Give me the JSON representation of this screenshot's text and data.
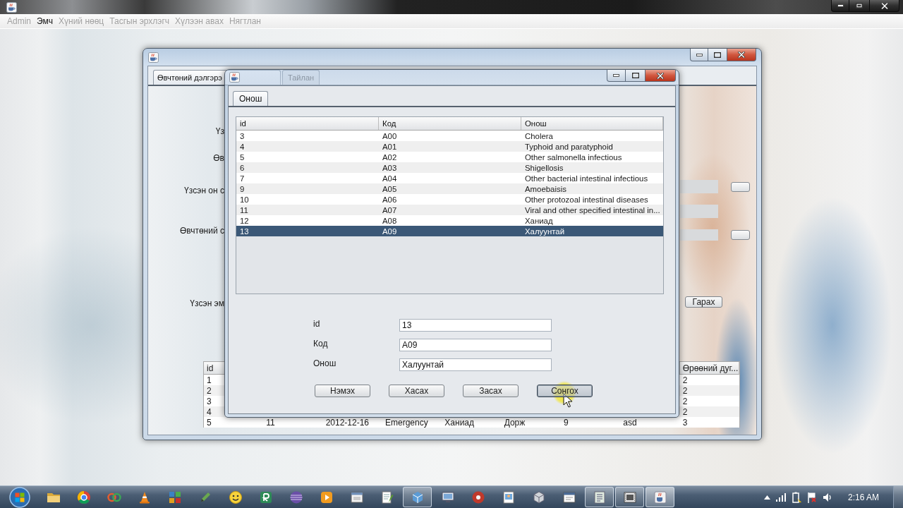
{
  "app_window": {
    "menu": [
      {
        "label": "Admin",
        "enabled": false
      },
      {
        "label": "Эмч",
        "enabled": true
      },
      {
        "label": "Хүний нөөц",
        "enabled": false
      },
      {
        "label": "Тасгын эрхлэгч",
        "enabled": false
      },
      {
        "label": "Хүлээн авах",
        "enabled": false
      },
      {
        "label": "Нягтлан",
        "enabled": false
      }
    ]
  },
  "patient_window": {
    "tabs": [
      {
        "label": "Өвчтөний дэлгэрэ",
        "selected": true
      },
      {
        "label": "Тайлан",
        "selected": false
      }
    ],
    "field_labels": [
      "Үз",
      "Өв",
      "Үзсэн он с",
      "Өвчтөний с",
      "Үзсэн эм"
    ],
    "exit_button": "Гарах",
    "table": {
      "columns": [
        "id",
        null,
        null,
        null,
        null,
        null,
        null,
        null,
        "Өрөөний дуг..."
      ],
      "rows": [
        [
          "1",
          null,
          null,
          null,
          null,
          null,
          null,
          null,
          "2"
        ],
        [
          "2",
          null,
          null,
          null,
          null,
          null,
          null,
          null,
          "2"
        ],
        [
          "3",
          null,
          null,
          null,
          null,
          null,
          null,
          null,
          "2"
        ],
        [
          "4",
          null,
          null,
          null,
          null,
          null,
          null,
          null,
          "2"
        ],
        [
          "5",
          "11",
          "2012-12-16",
          "Emergency",
          "Ханиад",
          "Дорж",
          "9",
          "asd",
          "3"
        ]
      ]
    }
  },
  "diagnosis_dialog": {
    "tabs": [
      {
        "label": "Онош",
        "selected": true
      }
    ],
    "table": {
      "columns": [
        "id",
        "Код",
        "Онош"
      ],
      "rows": [
        {
          "cells": [
            "3",
            "A00",
            "Cholera"
          ],
          "selected": false
        },
        {
          "cells": [
            "4",
            "A01",
            "Typhoid and paratyphoid"
          ],
          "selected": false
        },
        {
          "cells": [
            "5",
            "A02",
            "Other salmonella infectious"
          ],
          "selected": false
        },
        {
          "cells": [
            "6",
            "A03",
            "Shigellosis"
          ],
          "selected": false
        },
        {
          "cells": [
            "7",
            "A04",
            "Other bacterial intestinal infectious"
          ],
          "selected": false
        },
        {
          "cells": [
            "9",
            "A05",
            "Amoebaisis"
          ],
          "selected": false
        },
        {
          "cells": [
            "10",
            "A06",
            "Other protozoal intestinal diseases"
          ],
          "selected": false
        },
        {
          "cells": [
            "11",
            "A07",
            "Viral and other specified intestinal in..."
          ],
          "selected": false
        },
        {
          "cells": [
            "12",
            "A08",
            "Ханиад"
          ],
          "selected": false
        },
        {
          "cells": [
            "13",
            "A09",
            "Халуунтай"
          ],
          "selected": true
        }
      ]
    },
    "form": [
      {
        "label": "id",
        "value": "13"
      },
      {
        "label": "Код",
        "value": "A09"
      },
      {
        "label": "Онош",
        "value": "Халуунтай"
      }
    ],
    "buttons": [
      {
        "label": "Нэмэх",
        "focused": false
      },
      {
        "label": "Хасах",
        "focused": false
      },
      {
        "label": "Засах",
        "focused": false
      },
      {
        "label": "Сонгох",
        "focused": true
      }
    ]
  },
  "taskbar": {
    "items": [
      {
        "running": false,
        "selected": false
      },
      {
        "running": false,
        "selected": false
      },
      {
        "running": false,
        "selected": false
      },
      {
        "running": false,
        "selected": false
      },
      {
        "running": false,
        "selected": false
      },
      {
        "running": false,
        "selected": false
      },
      {
        "running": false,
        "selected": false
      },
      {
        "running": false,
        "selected": false
      },
      {
        "running": false,
        "selected": false
      },
      {
        "running": false,
        "selected": false
      },
      {
        "running": false,
        "selected": false
      },
      {
        "running": false,
        "selected": false
      },
      {
        "running": true,
        "selected": false
      },
      {
        "running": false,
        "selected": false
      },
      {
        "running": false,
        "selected": false
      },
      {
        "running": false,
        "selected": false
      },
      {
        "running": false,
        "selected": false
      },
      {
        "running": false,
        "selected": false
      },
      {
        "running": true,
        "selected": false
      },
      {
        "running": true,
        "selected": false
      },
      {
        "running": true,
        "selected": true
      }
    ],
    "clock": "2:16 AM"
  }
}
